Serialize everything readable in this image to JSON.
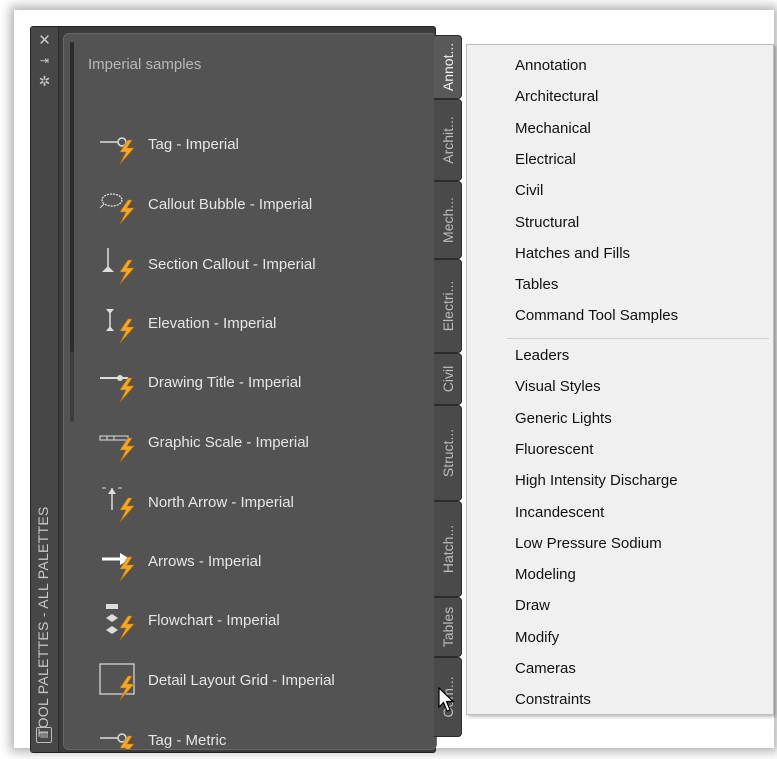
{
  "palette": {
    "title": "TOOL PALETTES - ALL PALETTES",
    "section": "Imperial samples",
    "tools": [
      {
        "label": "Tag - Imperial",
        "icon": "tag-icon"
      },
      {
        "label": "Callout Bubble - Imperial",
        "icon": "callout-bubble-icon"
      },
      {
        "label": "Section Callout - Imperial",
        "icon": "section-callout-icon"
      },
      {
        "label": "Elevation - Imperial",
        "icon": "elevation-icon"
      },
      {
        "label": "Drawing Title - Imperial",
        "icon": "drawing-title-icon"
      },
      {
        "label": "Graphic Scale - Imperial",
        "icon": "graphic-scale-icon"
      },
      {
        "label": "North Arrow - Imperial",
        "icon": "north-arrow-icon"
      },
      {
        "label": "Arrows - Imperial",
        "icon": "arrows-icon"
      },
      {
        "label": "Flowchart - Imperial",
        "icon": "flowchart-icon"
      },
      {
        "label": "Detail Layout Grid - Imperial",
        "icon": "detail-layout-grid-icon"
      },
      {
        "label": "Tag - Metric",
        "icon": "tag-icon"
      }
    ],
    "tabs": [
      "Annot...",
      "Archit...",
      "Mech...",
      "Electri...",
      "Civil",
      "Struct...",
      "Hatch...",
      "Tables",
      "Com..."
    ]
  },
  "menu": {
    "group1": [
      "Annotation",
      "Architectural",
      "Mechanical",
      "Electrical",
      "Civil",
      "Structural",
      "Hatches and Fills",
      "Tables",
      "Command Tool Samples"
    ],
    "group2": [
      "Leaders",
      "Visual Styles",
      "Generic Lights",
      "Fluorescent",
      "High Intensity Discharge",
      "Incandescent",
      "Low Pressure Sodium",
      "Modeling",
      "Draw",
      "Modify",
      "Cameras",
      "Constraints"
    ]
  },
  "colors": {
    "palette_bg": "#3b3b3b",
    "panel_bg": "#535353",
    "lightning_accent": "#f5a623",
    "menu_bg": "#f0f0f0"
  }
}
